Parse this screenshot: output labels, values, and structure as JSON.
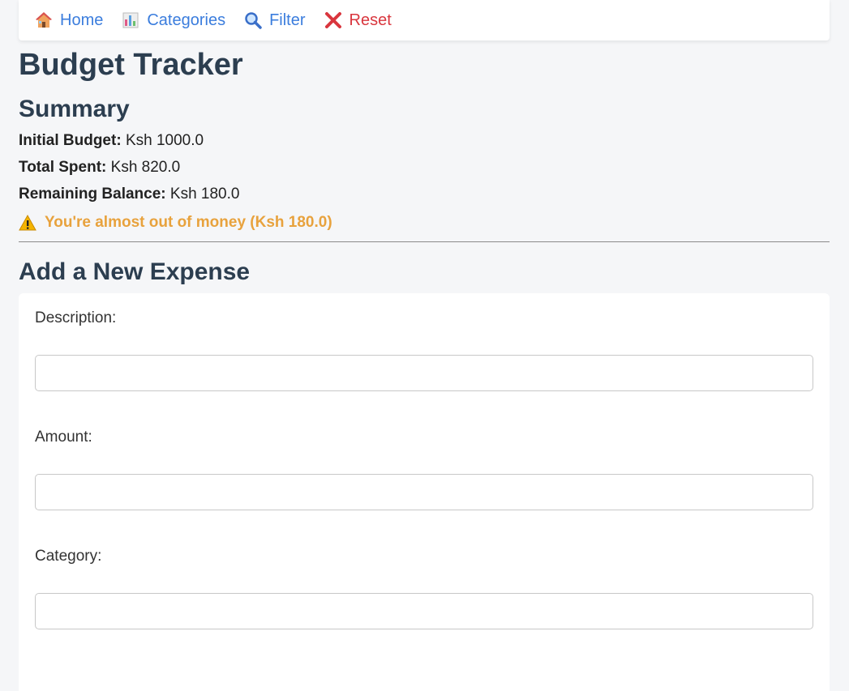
{
  "nav": {
    "items": [
      {
        "label": "Home",
        "icon": "home-icon"
      },
      {
        "label": "Categories",
        "icon": "bar-chart-icon"
      },
      {
        "label": "Filter",
        "icon": "magnifier-icon"
      },
      {
        "label": "Reset",
        "icon": "cross-icon"
      }
    ]
  },
  "page": {
    "title": "Budget Tracker"
  },
  "summary": {
    "title": "Summary",
    "initial_label": "Initial Budget:",
    "initial_value": "Ksh 1000.0",
    "spent_label": "Total Spent:",
    "spent_value": "Ksh 820.0",
    "remaining_label": "Remaining Balance:",
    "remaining_value": "Ksh 180.0",
    "warning": "You're almost out of money (Ksh 180.0)",
    "warning_icon": "warning-icon"
  },
  "form": {
    "title": "Add a New Expense",
    "description_label": "Description:",
    "description_value": "",
    "amount_label": "Amount:",
    "amount_value": "",
    "category_label": "Category:",
    "category_value": ""
  },
  "colors": {
    "nav_link": "#3b7ddd",
    "reset_link": "#d9363e",
    "warning": "#e8a23d",
    "heading": "#2c3e50",
    "background": "#f5f6f8"
  }
}
